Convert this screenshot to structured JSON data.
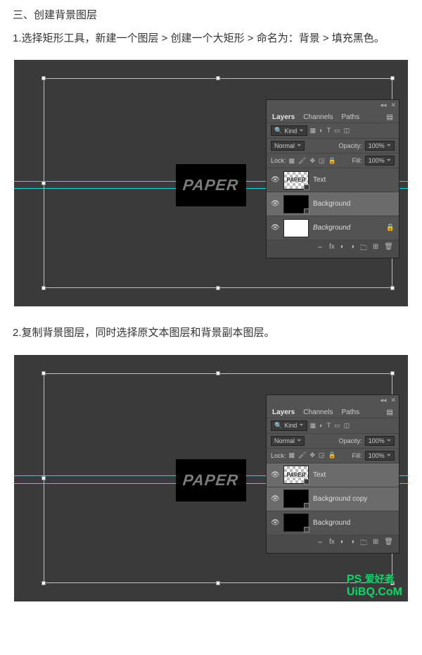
{
  "section_heading": "三、创建背景图层",
  "step1_text": "1.选择矩形工具，新建一个图层 > 创建一个大矩形 > 命名为：背景 > 填充黑色。",
  "step2_text": "2.复制背景图层，同时选择原文本图层和背景副本图层。",
  "canvas": {
    "paper_text": "PAPER"
  },
  "panel": {
    "tabs": {
      "layers": "Layers",
      "channels": "Channels",
      "paths": "Paths"
    },
    "kind_label": "Kind",
    "blend_mode": "Normal",
    "opacity_label": "Opacity:",
    "opacity_value": "100%",
    "lock_label": "Lock:",
    "fill_label": "Fill:",
    "fill_value": "100%"
  },
  "layers_shot1": [
    {
      "id": "text",
      "label": "Text",
      "thumb": "paper",
      "selected": false
    },
    {
      "id": "bg",
      "label": "Background",
      "thumb": "black",
      "selected": true
    },
    {
      "id": "bg-locked",
      "label": "Background",
      "thumb": "white",
      "selected": false
    }
  ],
  "layers_shot2": [
    {
      "id": "text",
      "label": "Text",
      "thumb": "paper",
      "selected": true
    },
    {
      "id": "bg-copy",
      "label": "Background copy",
      "thumb": "black",
      "selected": true
    },
    {
      "id": "bg",
      "label": "Background",
      "thumb": "black",
      "selected": false
    }
  ],
  "watermark": {
    "brand_left": "PS",
    "brand_cn": "爱好者",
    "site": "UiBQ.CoM"
  }
}
